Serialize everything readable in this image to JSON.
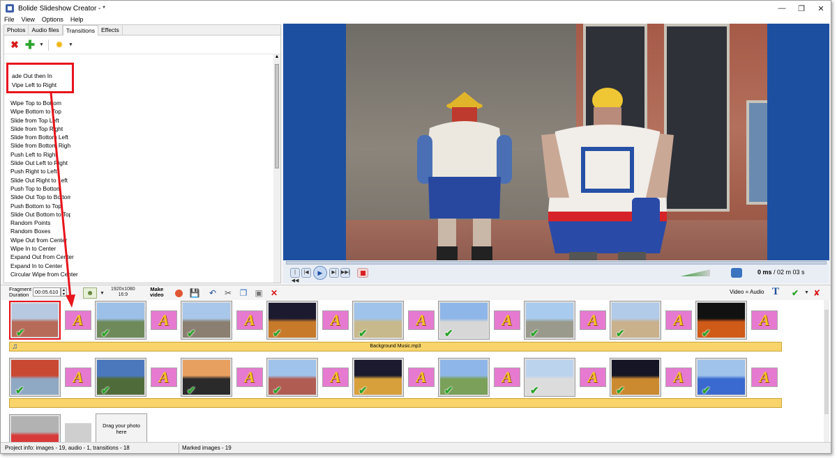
{
  "window": {
    "title": "Bolide Slideshow Creator - *"
  },
  "menu": [
    "File",
    "View",
    "Options",
    "Help"
  ],
  "tabs": [
    "Photos",
    "Audio files",
    "Transitions",
    "Effects"
  ],
  "transitions_list": {
    "highlighted": [
      "ade Out then In",
      "Vipe Left to Right"
    ],
    "items": [
      "Wipe Top to Bottom",
      "Wipe Bottom to Top",
      "Slide from Top Left",
      "Slide from Top Right",
      "Slide from Bottom Left",
      "Slide from Bottom Right",
      "Push Left to Right",
      "Slide Out Left to Right",
      "Push Right to Left",
      "Slide Out Right to Left",
      "Push Top to Bottom",
      "Slide Out Top to Bottom",
      "Push Bottom to Top",
      "Slide Out Bottom to Top",
      "Random Points",
      "Random Boxes",
      "Wipe Out from Center",
      "Wipe In to Center",
      "Expand Out from Center",
      "Expand In to Center",
      "Circular Wipe from Center"
    ]
  },
  "player": {
    "time_current": "0 ms",
    "time_total": " / 02 m 03 s"
  },
  "toolbar": {
    "fragment_label_1": "Fragment",
    "fragment_label_2": "Duration",
    "fragment_value": "00:05.610",
    "resolution": "1920x1080",
    "aspect": "16:9",
    "make_video_1": "Make",
    "make_video_2": "video",
    "video_audio": "Video = Audio",
    "text_tool": "T"
  },
  "timeline": {
    "transition_glyph": "A",
    "audio_track": "Background Music.mp3",
    "drag_1": "Drag your photo",
    "drag_2": "here"
  },
  "status": {
    "project_info": "Project info: images - 19, audio - 1, transitions - 18",
    "marked": "Marked images - 19"
  },
  "colors": {
    "accent": "#1d4fa0",
    "highlight": "#e8141c",
    "audio": "#f8d46a",
    "transition": "#e57ad0"
  }
}
